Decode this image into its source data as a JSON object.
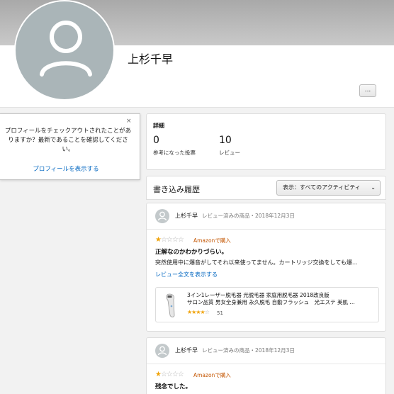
{
  "profile": {
    "name": "上杉千早",
    "more_label": "..."
  },
  "popover": {
    "message": "プロフィールをチェックアウトされたことがありますか？最新であることを確認してください。",
    "link": "プロフィールを表示する",
    "close": "×"
  },
  "stats": {
    "title": "詳細",
    "helpful_votes": "0",
    "helpful_label": "参考になった投票",
    "reviews": "10",
    "reviews_label": "レビュー"
  },
  "activity": {
    "title": "書き込み履歴",
    "filter_label": "表示：すべてのアクティビティ"
  },
  "reviews": [
    {
      "user": "上杉千早",
      "meta": "レビュー済みの商品・2018年12月3日",
      "rating": 1,
      "badge": "Amazonで購入",
      "title": "正解なのかわかりづらい。",
      "body": "突然使用中に爆音がしてそれ以来使ってません。カートリッジ交換をしても爆…",
      "read_more": "レビュー全文を表示する",
      "product_line1": "3イン1レーザー脱毛器 光脱毛器 家庭用脱毛器 2018改良版",
      "product_line2": "サロン品質 男女全身兼用 永久脱毛 自動フラッシュ　光エステ 美肌 …",
      "product_rating": 4,
      "product_count": "51"
    },
    {
      "user": "上杉千早",
      "meta": "レビュー済みの商品・2018年12月3日",
      "rating": 1,
      "badge": "Amazonで購入",
      "title": "残念でした。"
    }
  ],
  "colors": {
    "link": "#0066c0",
    "star": "#f0a30a",
    "badge": "#c45500",
    "avatar": "#aab5b8"
  }
}
